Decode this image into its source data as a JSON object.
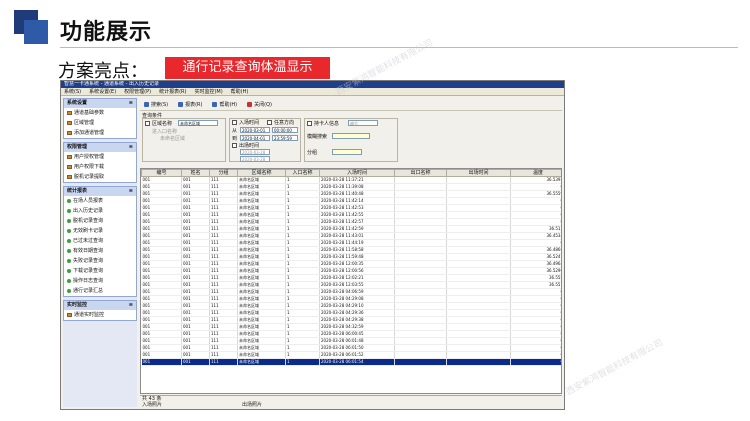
{
  "slide": {
    "title": "功能展示",
    "subtitle": "方案亮点：",
    "badge": "通行记录查询体温显示",
    "watermark": "西安紫鸿智能科技有限公司"
  },
  "app": {
    "title": "智慧一卡通系统 - 通道系统 - 出入历史记录",
    "menu": [
      "系统(S)",
      "系统设置(E)",
      "权限管理(P)",
      "统计报表(R)",
      "实时监控(M)",
      "帮助(H)"
    ],
    "toolbar": {
      "search": "搜索(S)",
      "report": "报表(R)",
      "help": "帮助(H)",
      "close": "关闭(Q)"
    },
    "sidebar": [
      {
        "title": "系统设置",
        "toggle": "≡",
        "items": [
          "通道基础参数",
          "区域管理",
          "添加通道管理"
        ]
      },
      {
        "title": "权限管理",
        "toggle": "≡",
        "items": [
          "用户授权管理",
          "用户权限下载",
          "脱机记录提取"
        ]
      },
      {
        "title": "统计报表",
        "toggle": "≡",
        "items": [
          "在场人员报表",
          "出入历史记录",
          "脱机记录查询",
          "无效刷卡记录",
          "已过未过查询",
          "有效日期查询",
          "失败记录查询",
          "下载记录查询",
          "操作日志查询",
          "通行记录汇总"
        ]
      },
      {
        "title": "实时监控",
        "toggle": "≡",
        "items": [
          "通道实时监控"
        ]
      }
    ],
    "query": {
      "group_label": "查询条件",
      "area_label": "区域名称",
      "area_value": "未命名区域",
      "area_sub": "进入口名称",
      "area_sub2": "未命名区域",
      "in_time_label": "入场时间",
      "direction_label": "任意方向",
      "from_label": "从",
      "to_label": "到",
      "from_date": "2020-03-01",
      "from_time": "00:00:00",
      "to_date": "2020-04-01",
      "to_time": "23:59:59",
      "out_time_label": "出场时间",
      "out_from_date": "2020-03-28",
      "out_to_date": "2020-03-28",
      "card_label": "持卡人信息",
      "card_value": "编号",
      "fuzzy_label": "模糊搜索",
      "group2_label": "分组"
    },
    "table": {
      "columns": [
        "编号",
        "姓名",
        "分组",
        "区域名称",
        "入口名称",
        "入场时间",
        "出口名称",
        "出场时间",
        "温度"
      ],
      "rows": [
        [
          "001",
          "001",
          "111",
          "未命名区域",
          "1",
          "2020-03-28 11:37:21",
          "",
          "",
          "36.5392"
        ],
        [
          "001",
          "001",
          "111",
          "未命名区域",
          "1",
          "2020-03-28 11:39:08",
          "",
          "",
          "0"
        ],
        [
          "001",
          "001",
          "111",
          "未命名区域",
          "1",
          "2020-03-28 11:40:48",
          "",
          "",
          "36.5559"
        ],
        [
          "001",
          "001",
          "111",
          "未命名区域",
          "1",
          "2020-03-28 11:42:14",
          "",
          "",
          "0"
        ],
        [
          "001",
          "001",
          "111",
          "未命名区域",
          "1",
          "2020-03-28 11:42:53",
          "",
          "",
          "0"
        ],
        [
          "001",
          "001",
          "111",
          "未命名区域",
          "1",
          "2020-03-28 11:42:55",
          "",
          "",
          "0"
        ],
        [
          "001",
          "001",
          "111",
          "未命名区域",
          "1",
          "2020-03-28 11:42:57",
          "",
          "",
          "0"
        ],
        [
          "001",
          "001",
          "111",
          "未命名区域",
          "1",
          "2020-03-28 11:42:59",
          "",
          "",
          "36.513"
        ],
        [
          "001",
          "001",
          "111",
          "未命名区域",
          "1",
          "2020-03-28 11:43:01",
          "",
          "",
          "36.4534"
        ],
        [
          "001",
          "001",
          "111",
          "未命名区域",
          "1",
          "2020-03-28 11:44:19",
          "",
          "",
          "0"
        ],
        [
          "001",
          "001",
          "111",
          "未命名区域",
          "1",
          "2020-03-28 11:58:58",
          "",
          "",
          "36.4866"
        ],
        [
          "001",
          "001",
          "111",
          "未命名区域",
          "1",
          "2020-03-28 11:59:48",
          "",
          "",
          "36.5247"
        ],
        [
          "001",
          "001",
          "111",
          "未命名区域",
          "1",
          "2020-03-28 12:00:35",
          "",
          "",
          "36.4964"
        ],
        [
          "001",
          "001",
          "111",
          "未命名区域",
          "1",
          "2020-03-28 12:00:56",
          "",
          "",
          "36.5296"
        ],
        [
          "001",
          "001",
          "111",
          "未命名区域",
          "1",
          "2020-03-28 12:02:21",
          "",
          "",
          "36.555"
        ],
        [
          "001",
          "001",
          "111",
          "未命名区域",
          "1",
          "2020-03-28 12:03:55",
          "",
          "",
          "36.551"
        ],
        [
          "001",
          "001",
          "111",
          "未命名区域",
          "1",
          "2020-03-28 04:06:59",
          "",
          "",
          "0"
        ],
        [
          "001",
          "001",
          "111",
          "未命名区域",
          "1",
          "2020-03-28 04:29:08",
          "",
          "",
          "0"
        ],
        [
          "001",
          "001",
          "111",
          "未命名区域",
          "1",
          "2020-03-28 04:29:10",
          "",
          "",
          "0"
        ],
        [
          "001",
          "001",
          "111",
          "未命名区域",
          "1",
          "2020-03-28 04:29:36",
          "",
          "",
          "0"
        ],
        [
          "001",
          "001",
          "111",
          "未命名区域",
          "1",
          "2020-03-28 04:29:38",
          "",
          "",
          "0"
        ],
        [
          "001",
          "001",
          "111",
          "未命名区域",
          "1",
          "2020-03-28 04:32:59",
          "",
          "",
          "0"
        ],
        [
          "001",
          "001",
          "111",
          "未命名区域",
          "1",
          "2020-03-28 06:00:45",
          "",
          "",
          "0"
        ],
        [
          "001",
          "001",
          "111",
          "未命名区域",
          "1",
          "2020-03-28 06:01:48",
          "",
          "",
          "0"
        ],
        [
          "001",
          "001",
          "111",
          "未命名区域",
          "1",
          "2020-03-28 06:01:50",
          "",
          "",
          "0"
        ],
        [
          "001",
          "001",
          "111",
          "未命名区域",
          "1",
          "2020-03-28 06:01:52",
          "",
          "",
          "0"
        ],
        [
          "001",
          "001",
          "111",
          "未命名区域",
          "1",
          "2020-03-28 06:01:54",
          "",
          "",
          "0"
        ]
      ],
      "selected_index": 26
    },
    "status": {
      "count": "共 43 条",
      "in_label": "入场照片",
      "out_label": "出场照片"
    }
  }
}
